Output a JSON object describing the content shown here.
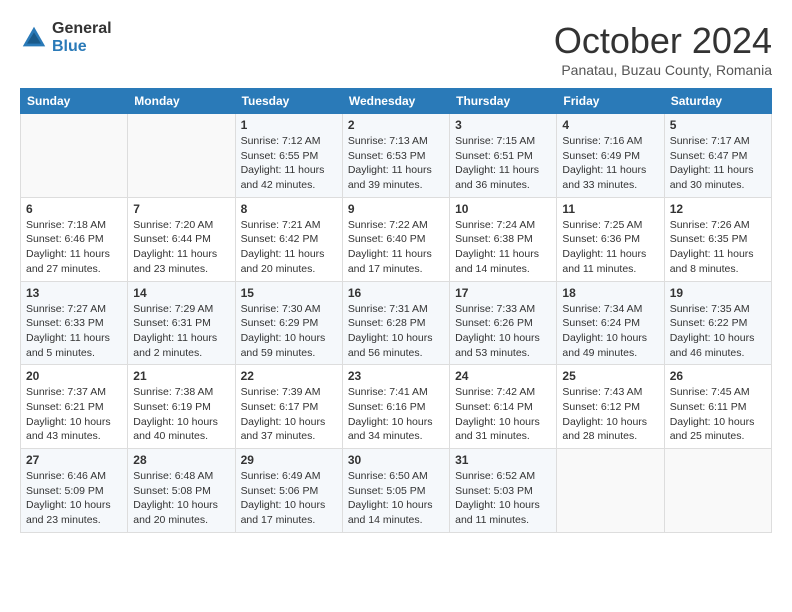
{
  "logo": {
    "general": "General",
    "blue": "Blue"
  },
  "header": {
    "month": "October 2024",
    "location": "Panatau, Buzau County, Romania"
  },
  "weekdays": [
    "Sunday",
    "Monday",
    "Tuesday",
    "Wednesday",
    "Thursday",
    "Friday",
    "Saturday"
  ],
  "weeks": [
    [
      {
        "day": "",
        "info": ""
      },
      {
        "day": "",
        "info": ""
      },
      {
        "day": "1",
        "info": "Sunrise: 7:12 AM\nSunset: 6:55 PM\nDaylight: 11 hours and 42 minutes."
      },
      {
        "day": "2",
        "info": "Sunrise: 7:13 AM\nSunset: 6:53 PM\nDaylight: 11 hours and 39 minutes."
      },
      {
        "day": "3",
        "info": "Sunrise: 7:15 AM\nSunset: 6:51 PM\nDaylight: 11 hours and 36 minutes."
      },
      {
        "day": "4",
        "info": "Sunrise: 7:16 AM\nSunset: 6:49 PM\nDaylight: 11 hours and 33 minutes."
      },
      {
        "day": "5",
        "info": "Sunrise: 7:17 AM\nSunset: 6:47 PM\nDaylight: 11 hours and 30 minutes."
      }
    ],
    [
      {
        "day": "6",
        "info": "Sunrise: 7:18 AM\nSunset: 6:46 PM\nDaylight: 11 hours and 27 minutes."
      },
      {
        "day": "7",
        "info": "Sunrise: 7:20 AM\nSunset: 6:44 PM\nDaylight: 11 hours and 23 minutes."
      },
      {
        "day": "8",
        "info": "Sunrise: 7:21 AM\nSunset: 6:42 PM\nDaylight: 11 hours and 20 minutes."
      },
      {
        "day": "9",
        "info": "Sunrise: 7:22 AM\nSunset: 6:40 PM\nDaylight: 11 hours and 17 minutes."
      },
      {
        "day": "10",
        "info": "Sunrise: 7:24 AM\nSunset: 6:38 PM\nDaylight: 11 hours and 14 minutes."
      },
      {
        "day": "11",
        "info": "Sunrise: 7:25 AM\nSunset: 6:36 PM\nDaylight: 11 hours and 11 minutes."
      },
      {
        "day": "12",
        "info": "Sunrise: 7:26 AM\nSunset: 6:35 PM\nDaylight: 11 hours and 8 minutes."
      }
    ],
    [
      {
        "day": "13",
        "info": "Sunrise: 7:27 AM\nSunset: 6:33 PM\nDaylight: 11 hours and 5 minutes."
      },
      {
        "day": "14",
        "info": "Sunrise: 7:29 AM\nSunset: 6:31 PM\nDaylight: 11 hours and 2 minutes."
      },
      {
        "day": "15",
        "info": "Sunrise: 7:30 AM\nSunset: 6:29 PM\nDaylight: 10 hours and 59 minutes."
      },
      {
        "day": "16",
        "info": "Sunrise: 7:31 AM\nSunset: 6:28 PM\nDaylight: 10 hours and 56 minutes."
      },
      {
        "day": "17",
        "info": "Sunrise: 7:33 AM\nSunset: 6:26 PM\nDaylight: 10 hours and 53 minutes."
      },
      {
        "day": "18",
        "info": "Sunrise: 7:34 AM\nSunset: 6:24 PM\nDaylight: 10 hours and 49 minutes."
      },
      {
        "day": "19",
        "info": "Sunrise: 7:35 AM\nSunset: 6:22 PM\nDaylight: 10 hours and 46 minutes."
      }
    ],
    [
      {
        "day": "20",
        "info": "Sunrise: 7:37 AM\nSunset: 6:21 PM\nDaylight: 10 hours and 43 minutes."
      },
      {
        "day": "21",
        "info": "Sunrise: 7:38 AM\nSunset: 6:19 PM\nDaylight: 10 hours and 40 minutes."
      },
      {
        "day": "22",
        "info": "Sunrise: 7:39 AM\nSunset: 6:17 PM\nDaylight: 10 hours and 37 minutes."
      },
      {
        "day": "23",
        "info": "Sunrise: 7:41 AM\nSunset: 6:16 PM\nDaylight: 10 hours and 34 minutes."
      },
      {
        "day": "24",
        "info": "Sunrise: 7:42 AM\nSunset: 6:14 PM\nDaylight: 10 hours and 31 minutes."
      },
      {
        "day": "25",
        "info": "Sunrise: 7:43 AM\nSunset: 6:12 PM\nDaylight: 10 hours and 28 minutes."
      },
      {
        "day": "26",
        "info": "Sunrise: 7:45 AM\nSunset: 6:11 PM\nDaylight: 10 hours and 25 minutes."
      }
    ],
    [
      {
        "day": "27",
        "info": "Sunrise: 6:46 AM\nSunset: 5:09 PM\nDaylight: 10 hours and 23 minutes."
      },
      {
        "day": "28",
        "info": "Sunrise: 6:48 AM\nSunset: 5:08 PM\nDaylight: 10 hours and 20 minutes."
      },
      {
        "day": "29",
        "info": "Sunrise: 6:49 AM\nSunset: 5:06 PM\nDaylight: 10 hours and 17 minutes."
      },
      {
        "day": "30",
        "info": "Sunrise: 6:50 AM\nSunset: 5:05 PM\nDaylight: 10 hours and 14 minutes."
      },
      {
        "day": "31",
        "info": "Sunrise: 6:52 AM\nSunset: 5:03 PM\nDaylight: 10 hours and 11 minutes."
      },
      {
        "day": "",
        "info": ""
      },
      {
        "day": "",
        "info": ""
      }
    ]
  ]
}
